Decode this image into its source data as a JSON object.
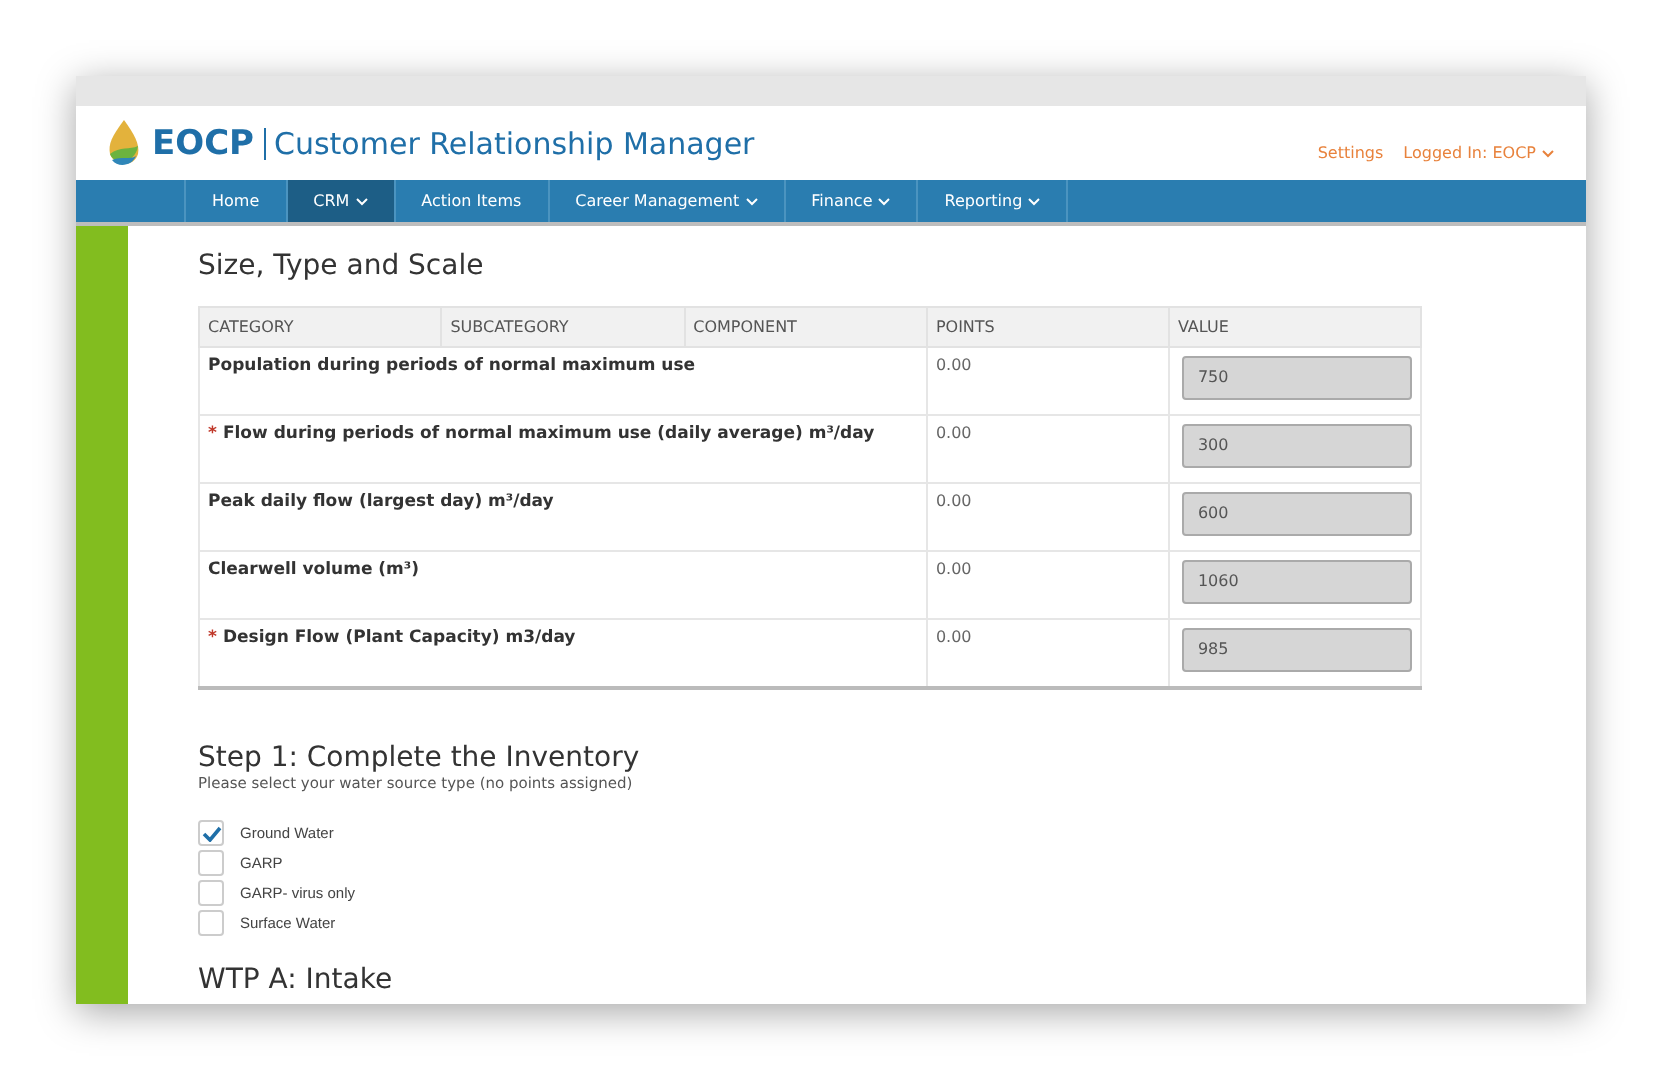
{
  "header": {
    "brand": "EOCP",
    "app_title": "Customer Relationship Manager",
    "links": [
      {
        "label": "Settings",
        "dropdown": false
      },
      {
        "label": "Logged In: EOCP",
        "dropdown": true
      }
    ]
  },
  "nav": [
    {
      "label": "Home",
      "dropdown": false,
      "selected": false
    },
    {
      "label": "CRM",
      "dropdown": true,
      "selected": true
    },
    {
      "label": "Action Items",
      "dropdown": false,
      "selected": false
    },
    {
      "label": "Career Management",
      "dropdown": true,
      "selected": false
    },
    {
      "label": "Finance",
      "dropdown": true,
      "selected": false
    },
    {
      "label": "Reporting",
      "dropdown": true,
      "selected": false
    }
  ],
  "section_title": "Size, Type and Scale",
  "table": {
    "columns": [
      "CATEGORY",
      "SUBCATEGORY",
      "COMPONENT",
      "POINTS",
      "VALUE"
    ],
    "rows": [
      {
        "category": "Population during periods of normal maximum use",
        "points": "0.00",
        "value": "750"
      },
      {
        "required_mark": "*",
        "category": "Flow during periods of normal maximum use (daily average) m³/day",
        "points": "0.00",
        "value": "300"
      },
      {
        "category": "Peak daily flow (largest day) m³/day",
        "points": "0.00",
        "value": "600"
      },
      {
        "category": "Clearwell volume (m³)",
        "points": "0.00",
        "value": "1060"
      },
      {
        "required_mark": "*",
        "category": "Design Flow (Plant Capacity) m3/day",
        "points": "0.00",
        "value": "985"
      }
    ]
  },
  "step": {
    "title": "Step 1: Complete the Inventory",
    "subtitle": "Please select your water source type (no points assigned)",
    "options": [
      {
        "label": "Ground Water",
        "checked": true
      },
      {
        "label": "GARP",
        "checked": false
      },
      {
        "label": "GARP- virus only",
        "checked": false
      },
      {
        "label": "Surface Water",
        "checked": false
      }
    ]
  },
  "next_title": "WTP A: Intake"
}
